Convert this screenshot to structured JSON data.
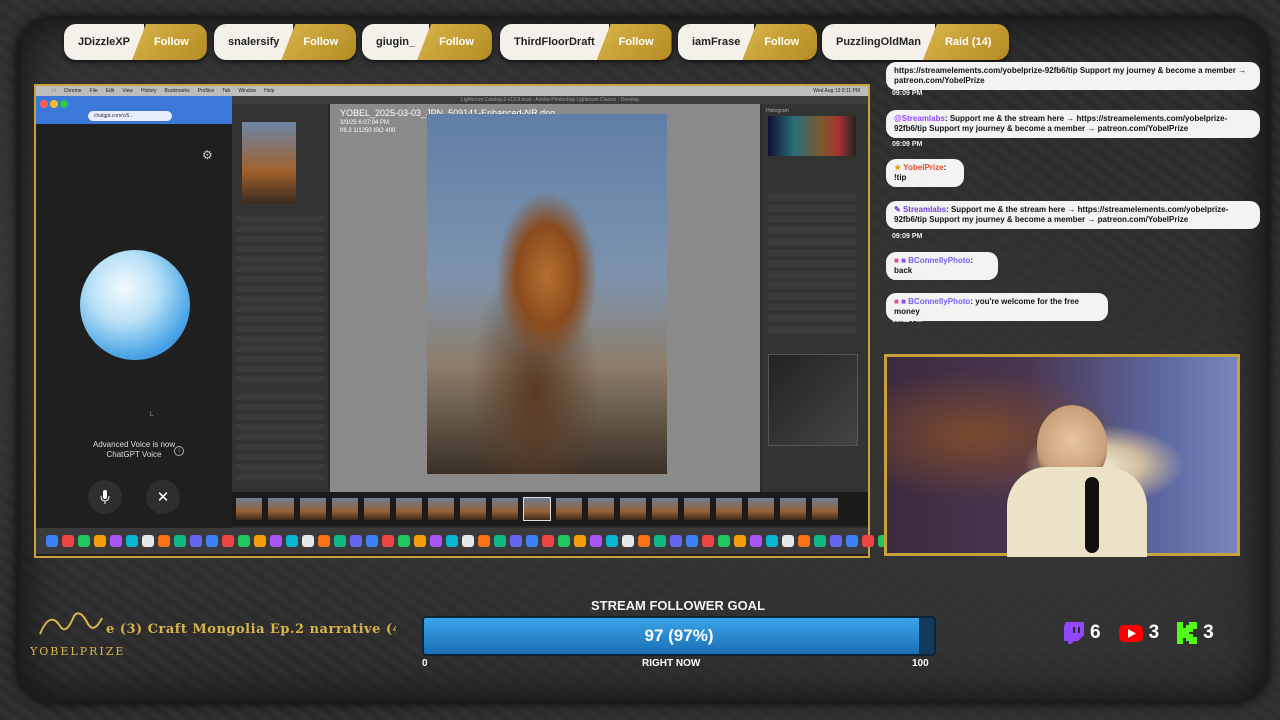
{
  "banner": {
    "items": [
      {
        "name": "JDizzleXP",
        "action": "Follow"
      },
      {
        "name": "snalersify",
        "action": "Follow"
      },
      {
        "name": "giugin_",
        "action": "Follow"
      },
      {
        "name": "ThirdFloorDraft",
        "action": "Follow"
      },
      {
        "name": "iamFrase",
        "action": "Follow"
      },
      {
        "name": "PuzzlingOldMan",
        "action": "Raid (14)"
      }
    ]
  },
  "desktop": {
    "menubar": [
      "Chrome",
      "File",
      "Edit",
      "View",
      "History",
      "Bookmarks",
      "Profiles",
      "Tab",
      "Window",
      "Help"
    ],
    "clock": "Wed Aug 13  9:11 PM",
    "chatgpt": {
      "url": "chatgpt.com/c/6...",
      "voice_line1": "Advanced Voice is now",
      "voice_line2": "ChatGPT Voice",
      "caption_char": "L"
    },
    "lightroom": {
      "title_bar": "Lightroom Catalog-2-v13-3.lrcat - Adobe Photoshop Lightroom Classic - Develop",
      "filename": "YOBEL_2025-03-03_JPN_509141-Enhanced-NR.dng",
      "meta1": "3/3/25 6:07:04 PM",
      "meta2": "f/6.3 1/1250 ISO 400",
      "panel_histogram": "Histogram"
    }
  },
  "chat": {
    "messages": [
      {
        "user": "",
        "text": "https://streamelements.com/yobelprize-92fb6/tip Support my journey & become a member → patreon.com/YobelPrize",
        "time": "09:09 PM"
      },
      {
        "user": "@Streamlabs",
        "text": ": Support me & the stream here → https://streamelements.com/yobelprize-92fb6/tip Support my journey & become a member → patreon.com/YobelPrize",
        "time": "09:09 PM"
      },
      {
        "user": "YobelPrize",
        "text": ": !tip",
        "time": "09:09 PM"
      },
      {
        "user": "Streamlabs",
        "text": ": Support me & the stream here → https://streamelements.com/yobelprize-92fb6/tip Support my journey & become a member → patreon.com/YobelPrize",
        "time": "09:09 PM"
      },
      {
        "user": "BConnellyPhoto",
        "text": ": back",
        "time": "09:10 PM"
      },
      {
        "user": "BConnellyPhoto",
        "text": ": you're welcome for the free money",
        "time": "09:11 PM"
      }
    ]
  },
  "bottom": {
    "brand": "YOBELPRIZE",
    "ticker": "e (3) Craft Mongolia Ep.2 narrative (4)",
    "goal": {
      "title": "STREAM FOLLOWER GOAL",
      "current": 97,
      "display": "97 (97%)",
      "fraction": 0.97,
      "min_label": "0",
      "max_label": "100",
      "sub_label": "RIGHT NOW"
    },
    "platforms": [
      {
        "icon": "twitch-icon",
        "count": "6",
        "color": "#9146ff"
      },
      {
        "icon": "youtube-icon",
        "count": "3",
        "color": "#ff0000"
      },
      {
        "icon": "kick-icon",
        "count": "3",
        "color": "#53fc18"
      }
    ]
  }
}
